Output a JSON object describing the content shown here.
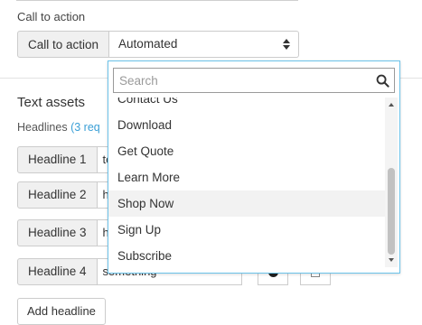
{
  "cta": {
    "section_label": "Call to action",
    "addon_label": "Call to action",
    "selected_value": "Automated"
  },
  "text_assets": {
    "title": "Text assets",
    "headlines_label": "Headlines",
    "headlines_requirement": "(3 req"
  },
  "headlines": [
    {
      "label": "Headline 1",
      "value": "te"
    },
    {
      "label": "Headline 2",
      "value": "he"
    },
    {
      "label": "Headline 3",
      "value": "h"
    },
    {
      "label": "Headline 4",
      "value": "something"
    }
  ],
  "add_headline_label": "Add headline",
  "dropdown": {
    "search_placeholder": "Search",
    "partial_item": "Contact Us",
    "items": [
      "Download",
      "Get Quote",
      "Learn More",
      "Shop Now",
      "Sign Up",
      "Subscribe"
    ],
    "hovered_item": "Shop Now"
  },
  "colors": {
    "focus_border": "#6cc3ea",
    "link_blue": "#3a9fd6",
    "hover_bg": "#f2f2f2"
  },
  "icons": [
    "search-icon",
    "select-arrows-icon",
    "scroll-up-icon",
    "scroll-down-icon",
    "trash-icon"
  ]
}
